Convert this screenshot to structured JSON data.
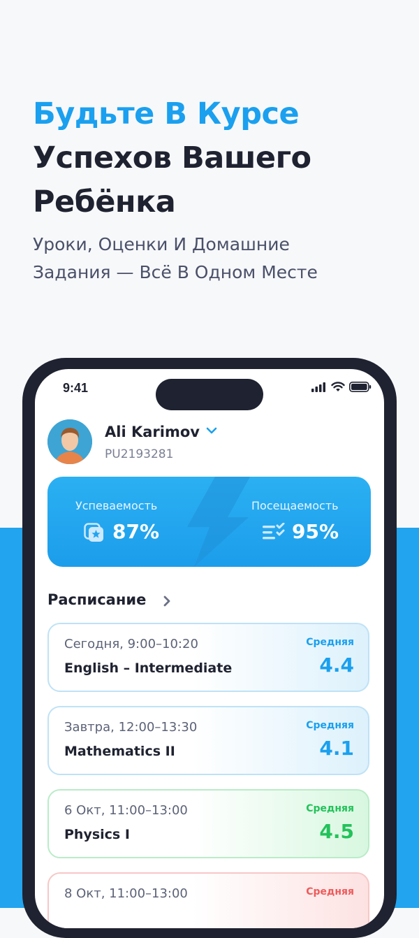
{
  "hero": {
    "title_accent": "Будьте В Курсе",
    "title_line2": "Успехов Вашего",
    "title_line3": "Ребёнка",
    "subtitle_line1": "Уроки, Оценки И Домашние",
    "subtitle_line2": "Задания — Всё В Одном Месте"
  },
  "status_bar": {
    "time": "9:41"
  },
  "user": {
    "name": "Ali Karimov",
    "id": "PU2193281"
  },
  "stats": {
    "performance_label": "Успеваемость",
    "performance_value": "87%",
    "attendance_label": "Посещаемость",
    "attendance_value": "95%"
  },
  "schedule": {
    "title": "Расписание",
    "items": [
      {
        "time": "Сегодня, 9:00–10:20",
        "subject": "English – Intermediate",
        "avg_label": "Средняя",
        "avg": "4.4",
        "tone": "blue"
      },
      {
        "time": "Завтра, 12:00–13:30",
        "subject": "Mathematics II",
        "avg_label": "Средняя",
        "avg": "4.1",
        "tone": "blue"
      },
      {
        "time": "6 Окт, 11:00–13:00",
        "subject": "Physics I",
        "avg_label": "Средняя",
        "avg": "4.5",
        "tone": "green"
      },
      {
        "time": "8 Окт, 11:00–13:00",
        "subject": "",
        "avg_label": "Средняя",
        "avg": "",
        "tone": "red"
      }
    ]
  },
  "colors": {
    "accent": "#1aa0ef",
    "dark": "#1f2230",
    "green": "#22c25a",
    "red": "#ef5b5b"
  }
}
